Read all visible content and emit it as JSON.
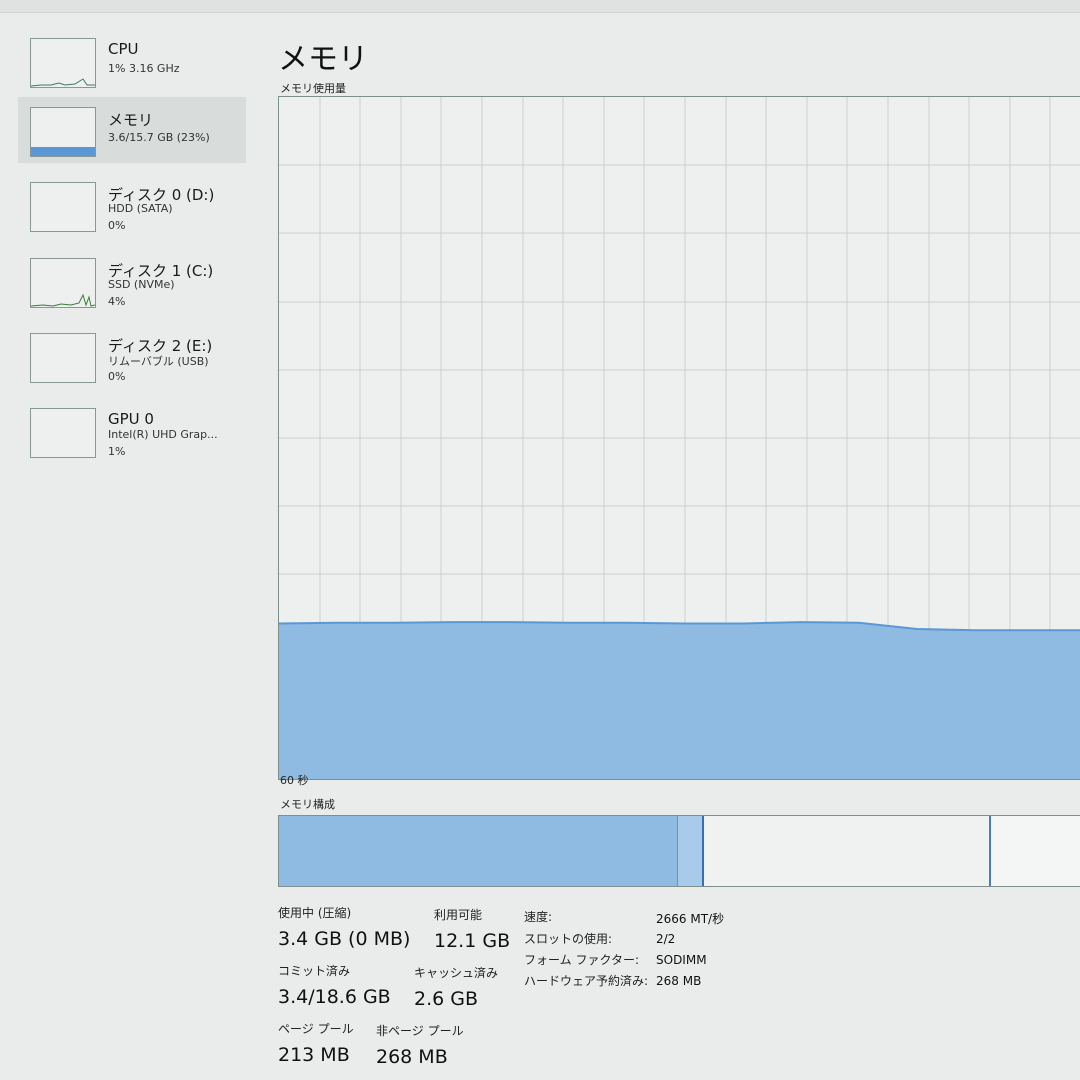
{
  "sidebar": {
    "items": [
      {
        "title": "CPU",
        "line1": "1%  3.16 GHz",
        "line2": ""
      },
      {
        "title": "メモリ",
        "line1": "3.6/15.7 GB (23%)",
        "line2": ""
      },
      {
        "title": "ディスク 0 (D:)",
        "line1": "HDD (SATA)",
        "line2": "0%"
      },
      {
        "title": "ディスク 1 (C:)",
        "line1": "SSD (NVMe)",
        "line2": "4%"
      },
      {
        "title": "ディスク 2 (E:)",
        "line1": "リムーバブル (USB)",
        "line2": "0%"
      },
      {
        "title": "GPU 0",
        "line1": "Intel(R) UHD Grap...",
        "line2": "1%"
      }
    ]
  },
  "main": {
    "title": "メモリ",
    "graph_label": "メモリ使用量",
    "time_label": "60 秒",
    "composition_label": "メモリ構成"
  },
  "memory_usage": {
    "fraction_used": 0.23,
    "trend_fraction": [
      0.228,
      0.229,
      0.229,
      0.23,
      0.23,
      0.229,
      0.229,
      0.228,
      0.228,
      0.23,
      0.229,
      0.22,
      0.218,
      0.218,
      0.218
    ]
  },
  "composition": {
    "in_use_fraction": 0.49,
    "modified_fraction": 0.03,
    "standby_fraction": 0.35,
    "free_fraction": 0.13
  },
  "stats": {
    "in_use_label": "使用中 (圧縮)",
    "in_use_value": "3.4 GB (0 MB)",
    "available_label": "利用可能",
    "available_value": "12.1 GB",
    "committed_label": "コミット済み",
    "committed_value": "3.4/18.6 GB",
    "cached_label": "キャッシュ済み",
    "cached_value": "2.6 GB",
    "paged_pool_label": "ページ プール",
    "paged_pool_value": "213 MB",
    "nonpaged_pool_label": "非ページ プール",
    "nonpaged_pool_value": "268 MB"
  },
  "properties": {
    "speed_label": "速度:",
    "speed_value": "2666 MT/秒",
    "slots_label": "スロットの使用:",
    "slots_value": "2/2",
    "form_factor_label": "フォーム ファクター:",
    "form_factor_value": "SODIMM",
    "hw_reserved_label": "ハードウェア予約済み:",
    "hw_reserved_value": "268 MB"
  },
  "colors": {
    "accent": "#5b97d6",
    "fill": "#8fbbe3",
    "grid": "#c9d0ce",
    "border": "#7f8f8b"
  }
}
